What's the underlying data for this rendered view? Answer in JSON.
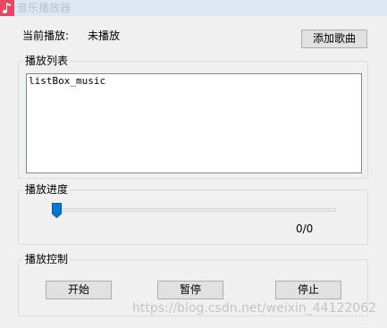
{
  "window": {
    "title": "音乐播放器",
    "app_icon": "music-note-icon",
    "icon_color": "#e8485f"
  },
  "now_playing": {
    "label": "当前播放:",
    "value": "未播放"
  },
  "add_button": {
    "label": "添加歌曲"
  },
  "playlist": {
    "title": "播放列表",
    "items": [
      "listBox_music"
    ]
  },
  "progress": {
    "title": "播放进度",
    "time": "0/0",
    "position_fraction": 0,
    "thumb_color": "#0078d7"
  },
  "controls": {
    "title": "播放控制",
    "start_label": "开始",
    "pause_label": "暂停",
    "stop_label": "停止"
  },
  "watermark": "https://blog.csdn.net/weixin_44122062"
}
